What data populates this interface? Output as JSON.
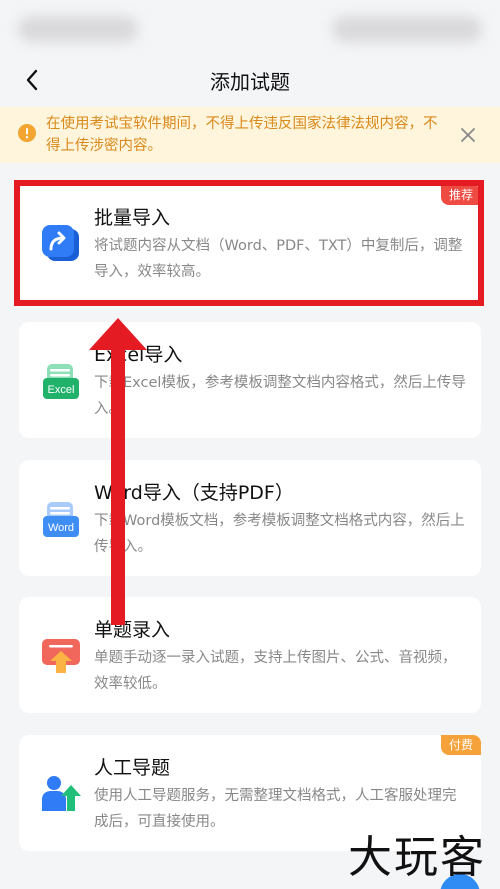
{
  "nav": {
    "title": "添加试题"
  },
  "notice": {
    "text": "在使用考试宝软件期间，不得上传违反国家法律法规内容，不得上传涉密内容。"
  },
  "cards": [
    {
      "title": "批量导入",
      "desc": "将试题内容从文档（Word、PDF、TXT）中复制后，调整导入，效率较高。",
      "badge": "推荐"
    },
    {
      "title": "Excel导入",
      "desc": "下载Excel模板，参考模板调整文档内容格式，然后上传导入。",
      "icon_text": "Excel"
    },
    {
      "title": "Word导入（支持PDF）",
      "desc": "下载Word模板文档，参考模板调整文档格式内容，然后上传导入。",
      "icon_text": "Word"
    },
    {
      "title": "单题录入",
      "desc": "单题手动逐一录入试题，支持上传图片、公式、音视频，效率较低。"
    },
    {
      "title": "人工导题",
      "desc": "使用人工导题服务，无需整理文档格式，人工客服处理完成后，可直接使用。",
      "badge": "付费"
    }
  ],
  "watermark": "大玩客",
  "colors": {
    "accent_blue": "#2f7cf6",
    "excel_green": "#20b26b",
    "word_blue": "#3f8ef5",
    "manual_red": "#f2675b",
    "notice_orange": "#d98a1a",
    "highlight_red": "#e51b24"
  }
}
